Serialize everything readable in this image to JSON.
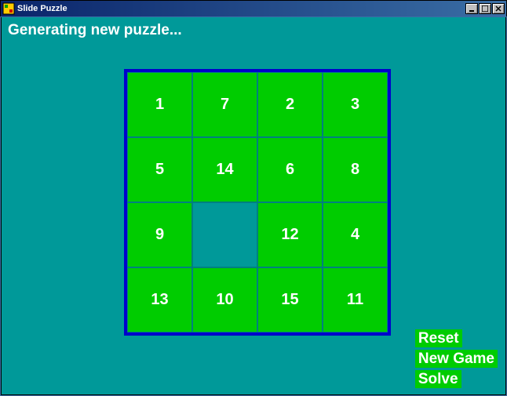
{
  "window": {
    "title": "Slide Puzzle"
  },
  "status_text": "Generating new puzzle...",
  "board": {
    "size": 4,
    "cells": [
      "1",
      "7",
      "2",
      "3",
      "5",
      "14",
      "6",
      "8",
      "9",
      "",
      "12",
      "4",
      "13",
      "10",
      "15",
      "11"
    ]
  },
  "actions": {
    "reset": "Reset",
    "new_game": "New Game",
    "solve": "Solve"
  },
  "colors": {
    "game_bg": "#009999",
    "tile": "#00cc00",
    "board_border": "#0000cc"
  }
}
